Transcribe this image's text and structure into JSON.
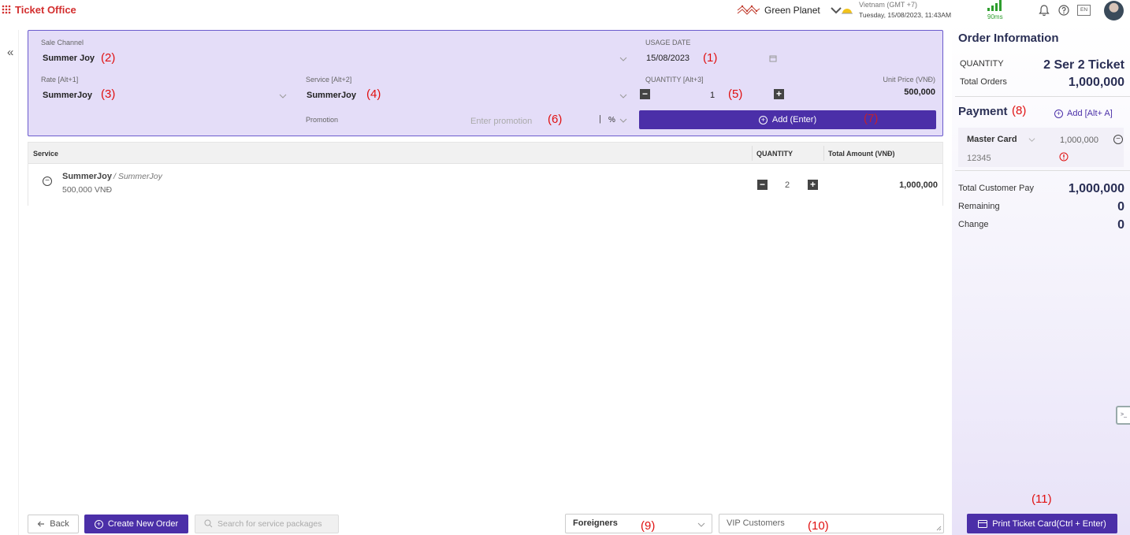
{
  "header": {
    "app_title": "Ticket Office",
    "brand": "Green Planet",
    "timezone": "Vietnam (GMT +7)",
    "datetime": "Tuesday, 15/08/2023, 11:43AM",
    "latency": "90ms",
    "language": "EN"
  },
  "form": {
    "sale_channel_label": "Sale Channel",
    "sale_channel_value": "Summer Joy",
    "usage_date_label": "USAGE DATE",
    "usage_date_value": "15/08/2023",
    "rate_label": "Rate [Alt+1]",
    "rate_value": "SummerJoy",
    "service_label": "Service [Alt+2]",
    "service_value": "SummerJoy",
    "quantity_label": "QUANTITY [Alt+3]",
    "quantity_value": "1",
    "unit_price_label": "Unit Price (VNĐ)",
    "unit_price_value": "500,000",
    "promotion_label": "Promotion",
    "promotion_placeholder": "Enter promotion",
    "promotion_unit": "%",
    "add_button": "Add (Enter)"
  },
  "annotations": {
    "n1": "(1)",
    "n2": "(2)",
    "n3": "(3)",
    "n4": "(4)",
    "n5": "(5)",
    "n6": "(6)",
    "n7": "(7)",
    "n8": "(8)",
    "n9": "(9)",
    "n10": "(10)",
    "n11": "(11)"
  },
  "table": {
    "col_service": "Service",
    "col_quantity": "QUANTITY",
    "col_total": "Total Amount (VNĐ)",
    "rows": [
      {
        "name": "SummerJoy",
        "sub": "/ SummerJoy",
        "price": "500,000 VNĐ",
        "quantity": "2",
        "total": "1,000,000"
      }
    ]
  },
  "bottom": {
    "back": "Back",
    "create_new_order": "Create New Order",
    "search_placeholder": "Search for service packages",
    "customer_type": "Foreigners",
    "vip_placeholder": "VIP Customers"
  },
  "order_info": {
    "title": "Order Information",
    "quantity_label": "QUANTITY",
    "quantity_value": "2 Ser 2 Ticket",
    "total_orders_label": "Total Orders",
    "total_orders_value": "1,000,000",
    "payment_title": "Payment",
    "payment_add": "Add [Alt+ A]",
    "payment_method": "Master Card",
    "payment_amount": "1,000,000",
    "card_number": "12345",
    "total_customer_pay_label": "Total Customer Pay",
    "total_customer_pay_value": "1,000,000",
    "remaining_label": "Remaining",
    "remaining_value": "0",
    "change_label": "Change",
    "change_value": "0",
    "print_button": "Print Ticket Card(Ctrl + Enter)"
  },
  "colors": {
    "primary": "#4b2fa8",
    "panel_bg": "#e4ddf8",
    "annotation_red": "#e01010",
    "brand_red": "#d32f2f"
  }
}
